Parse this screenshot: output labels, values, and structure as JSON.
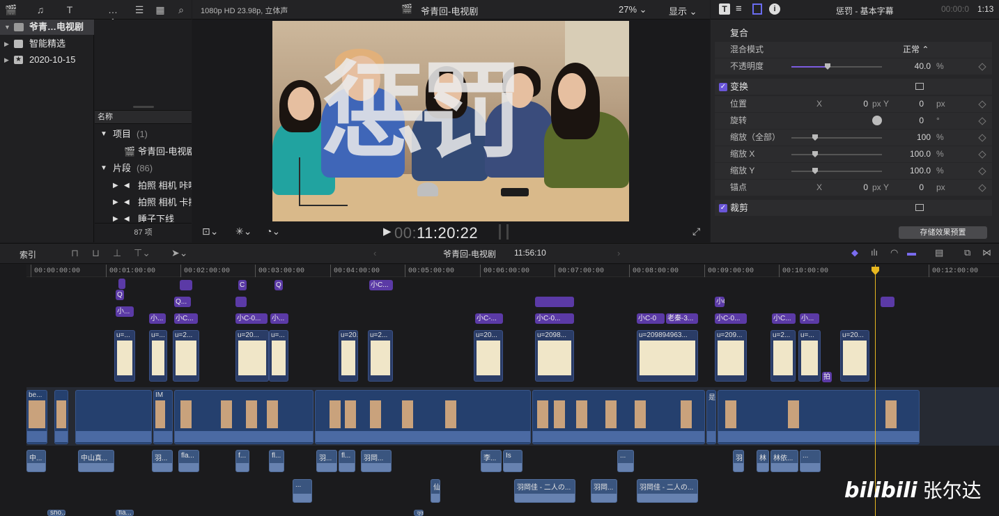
{
  "library": {
    "items": [
      {
        "label": "爷青…电视剧",
        "selected": true,
        "expanded": true
      },
      {
        "label": "智能精选",
        "selected": false,
        "expanded": false
      },
      {
        "label": "2020-10-15",
        "selected": false,
        "expanded": false
      }
    ]
  },
  "browser": {
    "column_header": "名称",
    "groups": [
      {
        "label": "项目",
        "count": "(1)"
      },
      {
        "label": "片段",
        "count": "(86)"
      }
    ],
    "project_item": "爷青回-电视剧",
    "clip_items": [
      "拍照 相机 咔嚓",
      "拍照 相机 卡擦",
      "睡子下线"
    ],
    "footer": "87 项"
  },
  "viewer": {
    "format": "1080p HD 23.98p, 立体声",
    "project_title": "爷青回-电视剧",
    "zoom": "27%",
    "display_label": "显示",
    "overlay_title": "惩罚",
    "timecode_dim": "00:",
    "timecode": "11:20:22"
  },
  "inspector": {
    "title": "惩罚 - 基本字幕",
    "duration_dim": "00:00:0",
    "duration": "1:13",
    "composite": {
      "header": "复合",
      "blend_mode_label": "混合模式",
      "blend_mode_value": "正常",
      "opacity_label": "不透明度",
      "opacity_value": "40.0",
      "opacity_fraction": 0.4,
      "unit_percent": "%"
    },
    "transform": {
      "header": "变换",
      "position_label": "位置",
      "axis_x": "X",
      "axis_y": "Y",
      "position_x": "0",
      "position_y": "0",
      "unit_px": "px",
      "rotation_label": "旋转",
      "rotation_value": "0",
      "unit_deg": "°",
      "scale_all_label": "缩放（全部）",
      "scale_all_value": "100",
      "scale_x_label": "缩放 X",
      "scale_x_value": "100.0",
      "scale_y_label": "缩放 Y",
      "scale_y_value": "100.0",
      "anchor_label": "锚点",
      "anchor_x": "0",
      "anchor_y": "0"
    },
    "crop": {
      "header": "裁剪"
    },
    "save_preset": "存储效果预置"
  },
  "timeline": {
    "index_label": "索引",
    "project": "爷青回-电视剧",
    "duration": "11:56:10",
    "ruler": [
      "00:00:00:00",
      "00:01:00:00",
      "00:02:00:00",
      "00:03:00:00",
      "00:04:00:00",
      "00:05:00:00",
      "00:06:00:00",
      "00:07:00:00",
      "00:08:00:00",
      "00:09:00:00",
      "00:10:00:00",
      "00:12:00:00"
    ],
    "title_clips": [
      "Q",
      "小...",
      "Q...",
      "小C...",
      "小C-0...",
      "小...",
      "小C-...",
      "小C-0...",
      "小C-0",
      "老秦-3...",
      "小C-0...",
      "小C...",
      "小...",
      "小C...",
      "Q",
      "C",
      "小C...",
      "拍"
    ],
    "gen_clips": [
      "u=...",
      "u=...",
      "u=2...",
      "u=20...",
      "u=...",
      "u=20...",
      "u=2...",
      "u=2098...",
      "u=209894963...",
      "u=209...",
      "u=2...",
      "u=...",
      "u=20..."
    ],
    "video_labels": [
      "be...",
      "I",
      "IM",
      "是"
    ],
    "audio_clips": [
      "中...",
      "中山真...",
      "羽...",
      "fla...",
      "f...",
      "fl...",
      "羽...",
      "fl...",
      "羽岡...",
      "李...",
      "Is",
      "...",
      "羽",
      "林",
      "林依...",
      "...",
      "羽岡佳 - 二人の...",
      "羽岡...",
      "羽岡佳 - 二人の...",
      "...",
      "仙",
      "sho...",
      "fla...",
      "羽"
    ]
  },
  "watermark": {
    "logo": "bilibili",
    "name": "张尔达"
  },
  "colors": {
    "accent": "#6a56d8",
    "playhead": "#e8b820",
    "title_clip": "#5b3aa6",
    "video_clip": "#25406e"
  }
}
